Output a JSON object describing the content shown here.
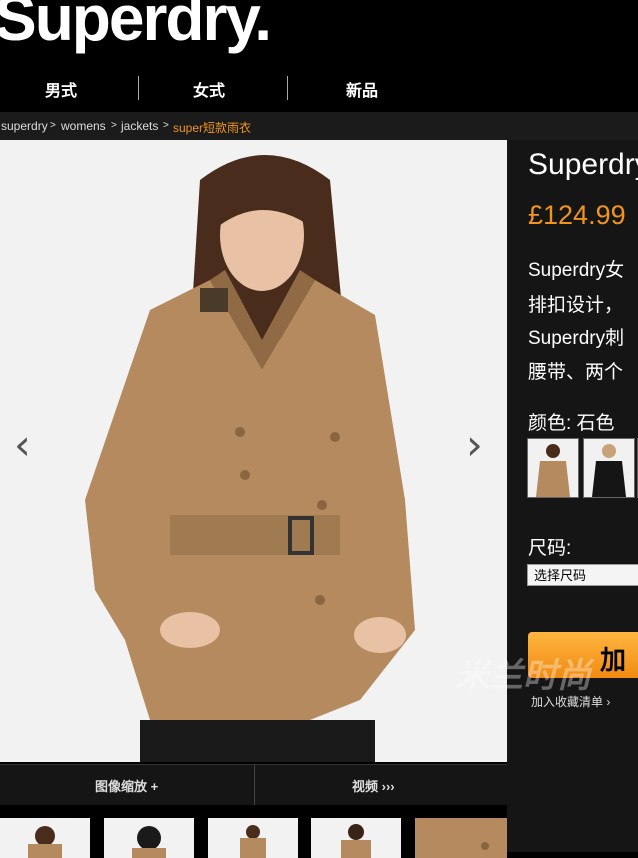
{
  "brand": {
    "logo_text": "Superdry."
  },
  "nav": {
    "items": [
      "男式",
      "女式",
      "新品"
    ]
  },
  "breadcrumb": {
    "items": [
      "superdry",
      "womens",
      "jackets"
    ],
    "separator": ">",
    "current": "super短款雨衣"
  },
  "product": {
    "title": "Superdry",
    "price": "£124.99",
    "description_lines": [
      "Superdry女",
      "排扣设计，",
      "Superdry刺",
      "腰带、两个"
    ],
    "color_label": "颜色: 石色",
    "size_label": "尺码:",
    "size_placeholder": "选择尺码",
    "add_button": "加",
    "wishlist": "加入收藏清单 ›"
  },
  "image_toolbar": {
    "zoom": "图像缩放 +",
    "video": "视频 ›››"
  },
  "icons": {
    "prev": "chevron-left-icon",
    "next": "chevron-right-icon"
  },
  "colors": {
    "accent": "#f0941d",
    "button": "#f5a12a",
    "background": "#000000",
    "panel": "#151515"
  },
  "watermark": "米兰时尚"
}
